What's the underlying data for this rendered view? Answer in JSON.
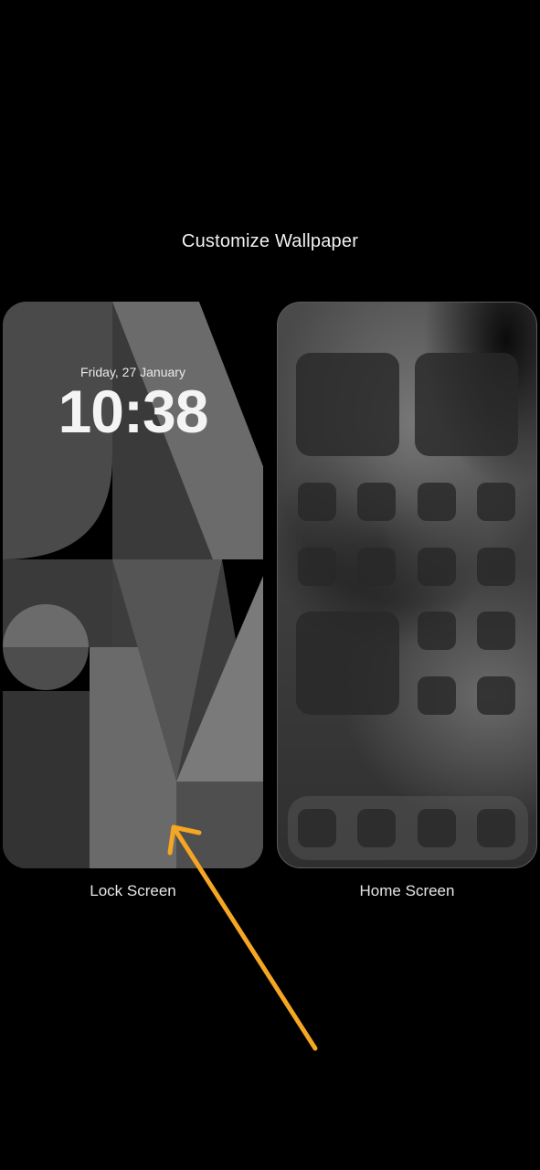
{
  "screen": {
    "title": "Customize Wallpaper"
  },
  "lock_screen": {
    "date": "Friday, 27 January",
    "time": "10:38",
    "label": "Lock Screen"
  },
  "home_screen": {
    "label": "Home Screen"
  },
  "annotation": {
    "arrow_color": "#f5a623"
  },
  "colors": {
    "background": "#000000",
    "text": "#ffffff"
  }
}
